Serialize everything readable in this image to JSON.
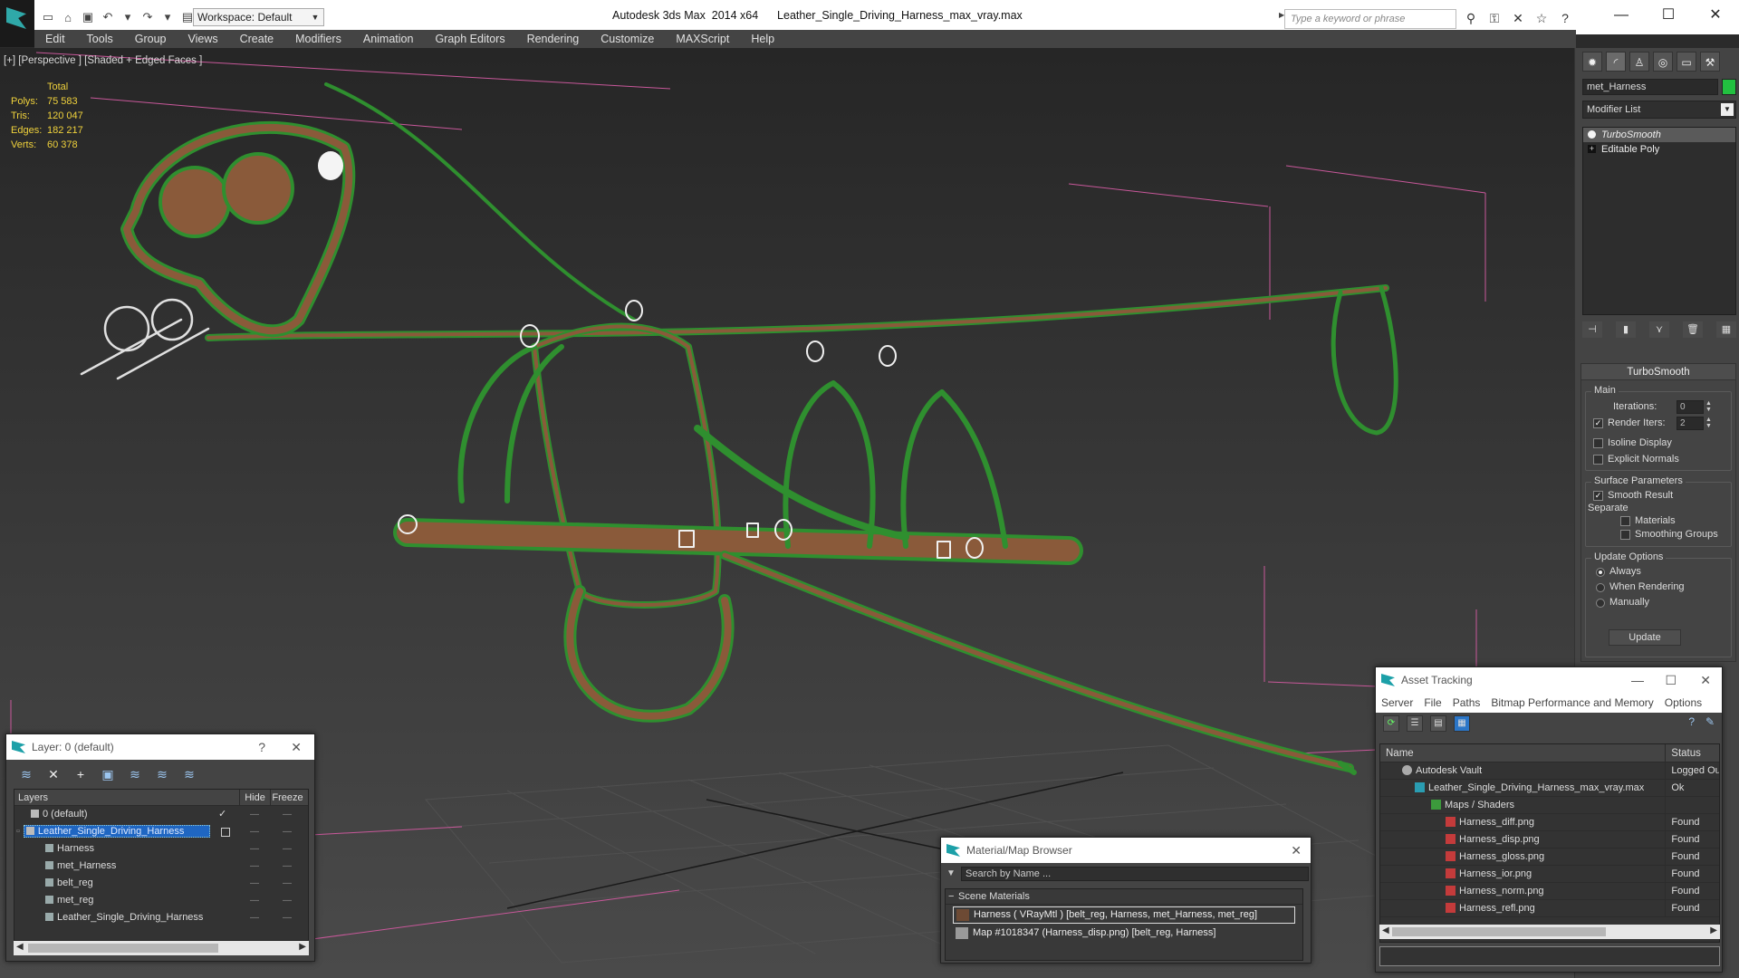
{
  "titlebar": {
    "workspace": "Workspace: Default",
    "title": "Autodesk 3ds Max  2014 x64      Leather_Single_Driving_Harness_max_vray.max",
    "search_placeholder": "Type a keyword or phrase"
  },
  "menu": [
    "Edit",
    "Tools",
    "Group",
    "Views",
    "Create",
    "Modifiers",
    "Animation",
    "Graph Editors",
    "Rendering",
    "Customize",
    "MAXScript",
    "Help"
  ],
  "viewport": {
    "label": "[+] [Perspective ] [Shaded + Edged Faces ]",
    "stats": {
      "total_label": "Total",
      "rows": [
        {
          "k": "Polys:",
          "v": "75 583"
        },
        {
          "k": "Tris:",
          "v": "120 047"
        },
        {
          "k": "Edges:",
          "v": "182 217"
        },
        {
          "k": "Verts:",
          "v": "60 378"
        }
      ]
    }
  },
  "command_panel": {
    "object_name": "met_Harness",
    "object_color": "#22c040",
    "modifier_list": "Modifier List",
    "stack": [
      "TurboSmooth",
      "Editable Poly"
    ],
    "rollout_title": "TurboSmooth",
    "main_label": "Main",
    "iterations_label": "Iterations:",
    "iterations_value": "0",
    "render_iters_label": "Render Iters:",
    "render_iters_value": "2",
    "isoline": "Isoline Display",
    "explicit_normals": "Explicit Normals",
    "surface_params": "Surface Parameters",
    "smooth_result": "Smooth Result",
    "separate": "Separate",
    "materials": "Materials",
    "smoothing_groups": "Smoothing Groups",
    "update_options": "Update Options",
    "always": "Always",
    "when_rendering": "When Rendering",
    "manually": "Manually",
    "update_button": "Update"
  },
  "layer_window": {
    "title": "Layer: 0 (default)",
    "col_layers": "Layers",
    "col_hide": "Hide",
    "col_freeze": "Freeze",
    "rows": [
      {
        "name": "0 (default)",
        "indent": 1
      },
      {
        "name": "Leather_Single_Driving_Harness",
        "indent": 1
      },
      {
        "name": "Harness",
        "indent": 2
      },
      {
        "name": "met_Harness",
        "indent": 2
      },
      {
        "name": "belt_reg",
        "indent": 2
      },
      {
        "name": "met_reg",
        "indent": 2
      },
      {
        "name": "Leather_Single_Driving_Harness",
        "indent": 2
      }
    ]
  },
  "material_browser": {
    "title": "Material/Map Browser",
    "search_placeholder": "Search by Name ...",
    "group": "Scene Materials",
    "items": [
      "Harness  ( VRayMtl )  [belt_reg, Harness, met_Harness, met_reg]",
      "Map #1018347 (Harness_disp.png) [belt_reg, Harness]"
    ]
  },
  "asset_tracking": {
    "title": "Asset Tracking",
    "menu": [
      "Server",
      "File",
      "Paths",
      "Bitmap Performance and Memory",
      "Options"
    ],
    "col_name": "Name",
    "col_status": "Status",
    "rows": [
      {
        "name": "Autodesk Vault",
        "status": "Logged Ou",
        "indent": 1
      },
      {
        "name": "Leather_Single_Driving_Harness_max_vray.max",
        "status": "Ok",
        "indent": 2
      },
      {
        "name": "Maps / Shaders",
        "status": "",
        "indent": 3
      },
      {
        "name": "Harness_diff.png",
        "status": "Found",
        "indent": 4
      },
      {
        "name": "Harness_disp.png",
        "status": "Found",
        "indent": 4
      },
      {
        "name": "Harness_gloss.png",
        "status": "Found",
        "indent": 4
      },
      {
        "name": "Harness_ior.png",
        "status": "Found",
        "indent": 4
      },
      {
        "name": "Harness_norm.png",
        "status": "Found",
        "indent": 4
      },
      {
        "name": "Harness_refl.png",
        "status": "Found",
        "indent": 4
      }
    ]
  }
}
